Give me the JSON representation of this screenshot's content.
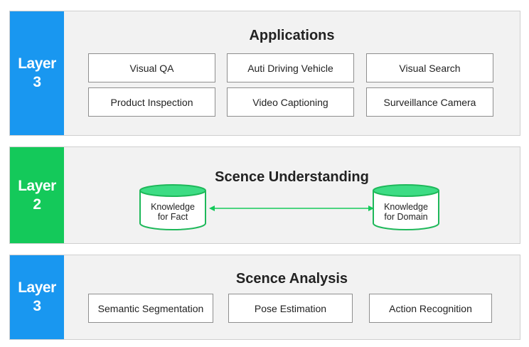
{
  "colors": {
    "blue": "#1997f0",
    "green": "#14c95a",
    "cylinder_top": "#3ddc84",
    "cylinder_stroke": "#1eb85a"
  },
  "top": {
    "tag_word": "Layer",
    "tag_num": "3",
    "title": "Applications",
    "items": [
      "Visual QA",
      "Auti Driving Vehicle",
      "Visual Search",
      "Product Inspection",
      "Video Captioning",
      "Surveillance Camera"
    ]
  },
  "middle": {
    "tag_word": "Layer",
    "tag_num": "2",
    "title": "Scence Understanding",
    "left_db": [
      "Knowledge",
      "for Fact"
    ],
    "right_db": [
      "Knowledge",
      "for Domain"
    ]
  },
  "bottom": {
    "tag_word": "Layer",
    "tag_num": "3",
    "title": "Scence Analysis",
    "items": [
      "Semantic Segmentation",
      "Pose Estimation",
      "Action Recognition"
    ]
  }
}
